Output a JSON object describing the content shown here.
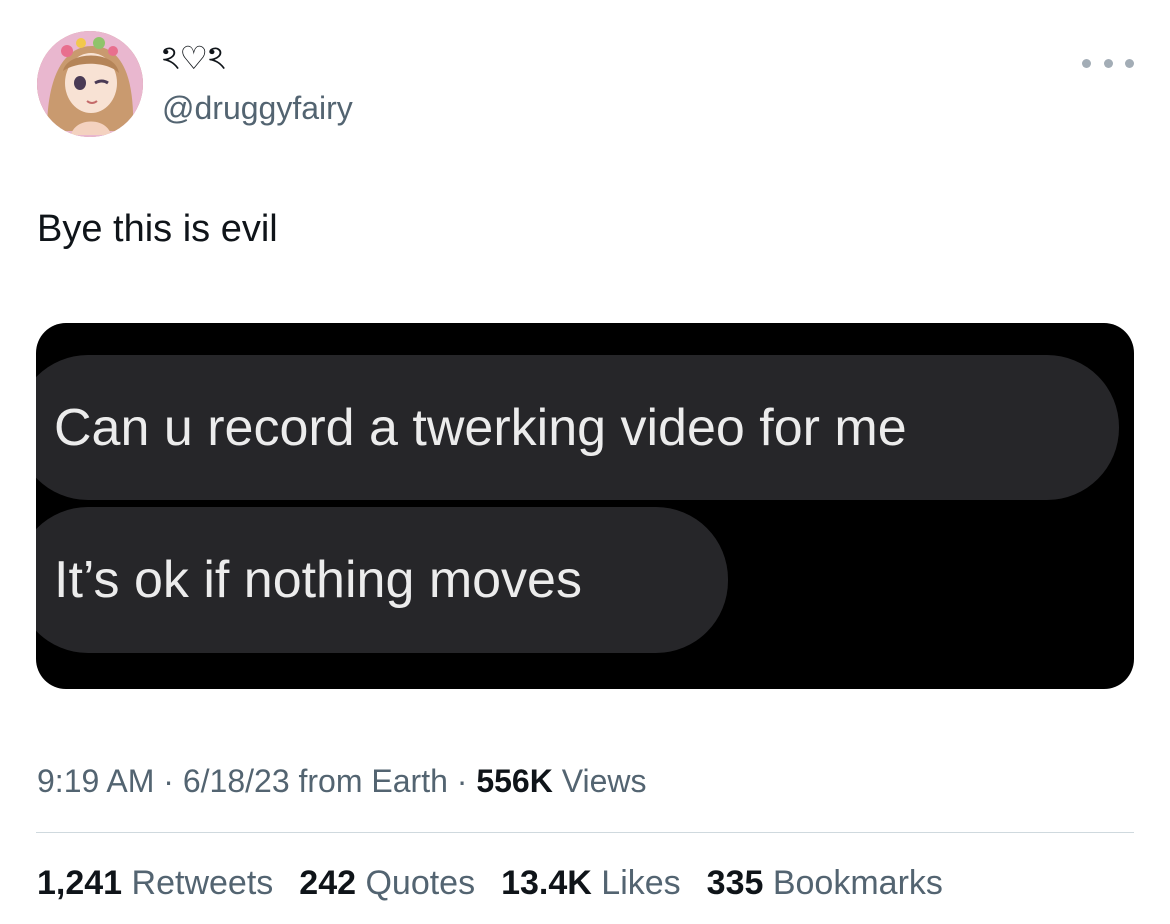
{
  "author": {
    "display_name": "ঽ♡ঽ",
    "handle": "@druggyfairy",
    "avatar_icon": "anime-girl-avatar"
  },
  "more_icon": "more-horizontal-icon",
  "tweet": {
    "text": "Bye this is evil"
  },
  "media": {
    "messages": [
      "Can u record a twerking video for me",
      "It’s ok if nothing moves"
    ]
  },
  "meta": {
    "time": "9:19 AM",
    "separator": "·",
    "date": "6/18/23",
    "source": "from Earth",
    "views_count": "556K",
    "views_label": "Views"
  },
  "stats": {
    "retweets_count": "1,241",
    "retweets_label": "Retweets",
    "quotes_count": "242",
    "quotes_label": "Quotes",
    "likes_count": "13.4K",
    "likes_label": "Likes",
    "bookmarks_count": "335",
    "bookmarks_label": "Bookmarks"
  },
  "colors": {
    "text_primary": "#0f1419",
    "text_secondary": "#536471",
    "bubble_bg": "#262629",
    "media_bg": "#000000",
    "divider": "#cfd9de"
  }
}
